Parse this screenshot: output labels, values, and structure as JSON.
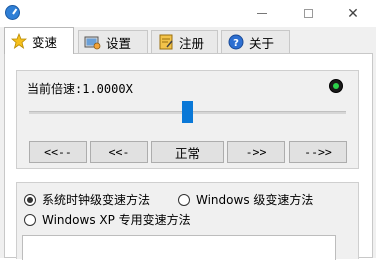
{
  "titlebar": {
    "icons": {
      "app": "app-icon",
      "minimize": "minimize-icon",
      "maximize": "maximize-icon",
      "close": "close-icon"
    },
    "close_glyph": "✕"
  },
  "tabs": [
    {
      "label": "变速",
      "icon": "star-icon",
      "active": true
    },
    {
      "label": "设置",
      "icon": "settings-icon",
      "active": false
    },
    {
      "label": "注册",
      "icon": "register-icon",
      "active": false
    },
    {
      "label": "关于",
      "icon": "help-icon",
      "active": false
    }
  ],
  "speed": {
    "label": "当前倍速:1.0000X",
    "slider_value_fraction": 0.5,
    "indicator_color": "#2bd14a",
    "buttons": [
      "<<--",
      "<<-",
      "正常",
      "->>",
      "-->>"
    ]
  },
  "methods": {
    "options": [
      {
        "label": "系统时钟级变速方法",
        "selected": true
      },
      {
        "label": "Windows 级变速方法",
        "selected": false
      },
      {
        "label": "Windows XP 专用变速方法",
        "selected": false
      }
    ]
  },
  "colors": {
    "accent": "#0a78d7"
  }
}
